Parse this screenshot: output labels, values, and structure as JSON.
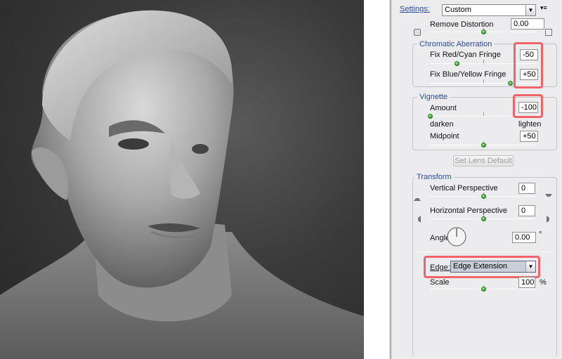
{
  "settings": {
    "label": "Settings:",
    "value": "Custom"
  },
  "remove_distortion": {
    "label": "Remove Distortion",
    "value": "0.00",
    "level": 0.5
  },
  "chromatic": {
    "title": "Chromatic Aberration",
    "red_cyan": {
      "label": "Fix Red/Cyan Fringe",
      "value": "-50",
      "level": 0.25
    },
    "blue_yellow": {
      "label": "Fix Blue/Yellow Fringe",
      "value": "+50",
      "level": 0.75
    }
  },
  "vignette": {
    "title": "Vignette",
    "amount": {
      "label": "Amount",
      "value": "-100",
      "level": 0.0
    },
    "darken": "darken",
    "lighten": "lighten",
    "midpoint": {
      "label": "Midpoint",
      "value": "+50",
      "level": 0.5
    }
  },
  "set_lens_default": "Set Lens Default",
  "transform": {
    "title": "Transform",
    "vertical": {
      "label": "Vertical Perspective",
      "value": "0",
      "level": 0.5
    },
    "horizontal": {
      "label": "Horizontal Perspective",
      "value": "0",
      "level": 0.5
    },
    "angle": {
      "label": "Angle:",
      "value": "0.00",
      "unit": "°"
    },
    "edge": {
      "label": "Edge:",
      "value": "Edge Extension"
    },
    "scale": {
      "label": "Scale",
      "value": "100",
      "unit": "%",
      "level": 0.5
    }
  },
  "colors": {
    "highlight": "#f0636a",
    "group_title": "#2b4aa5",
    "thumb": "#3aa632"
  }
}
